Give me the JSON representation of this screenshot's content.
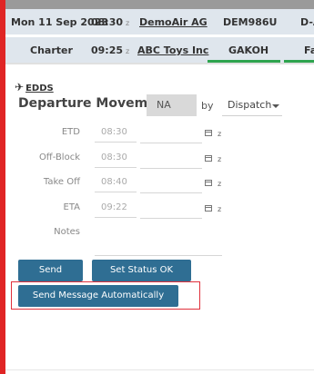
{
  "flights": [
    {
      "date": "Mon 11 Sep 2023",
      "time": "08:30",
      "time_zone": "z",
      "customer": "DemoAir AG",
      "registration": "DEM986U",
      "destination": "D-A"
    },
    {
      "type": "Charter",
      "time": "09:25",
      "time_zone": "z",
      "customer": "ABC Toys Inc",
      "registration": "GAKOH",
      "destination": "Falc"
    }
  ],
  "route": {
    "plane_icon": "plane-departure-icon",
    "airport": "EDDS"
  },
  "movement": {
    "title": "Departure Movement",
    "status": "NA",
    "by_label": "by",
    "by_value": "Dispatch"
  },
  "fields": [
    {
      "label": "ETD",
      "time": "08:30",
      "zone": "z"
    },
    {
      "label": "Off-Block",
      "time": "08:30",
      "zone": "z"
    },
    {
      "label": "Take Off",
      "time": "08:40",
      "zone": "z"
    },
    {
      "label": "ETA",
      "time": "09:22",
      "zone": "z"
    }
  ],
  "notes_label": "Notes",
  "buttons": {
    "send": "Send",
    "set_status": "Set Status OK",
    "send_auto": "Send Message Automatically"
  },
  "colors": {
    "accent_button": "#2f6e93",
    "left_bar": "#e02525",
    "status_green": "#2ea44f",
    "highlight": "#e0303b"
  }
}
